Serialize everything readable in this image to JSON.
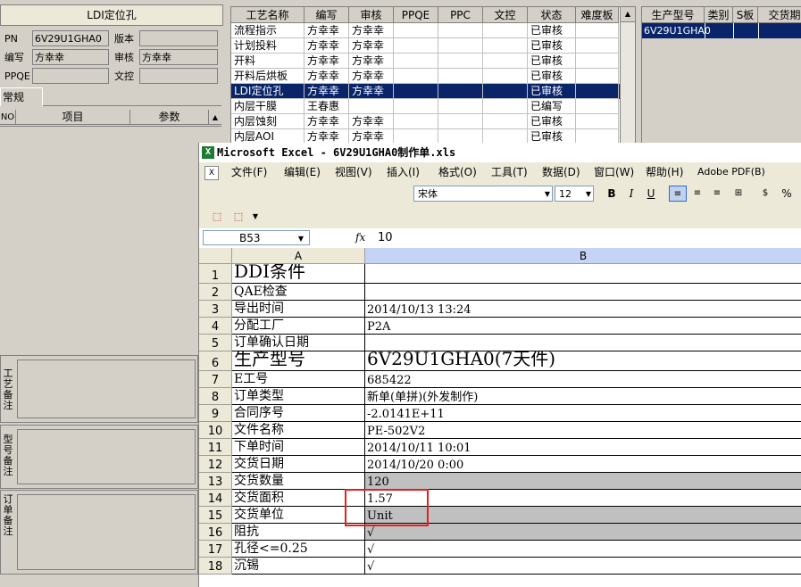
{
  "left": {
    "title": "LDI定位孔",
    "pn_label": "PN",
    "pn_value": "6V29U1GHA0",
    "version_label": "版本",
    "version_value": "",
    "author_label": "编写",
    "author_value": "方幸幸",
    "review_label": "审核",
    "review_value": "方幸幸",
    "ppqe_label": "PPQE",
    "ppqe_value": "",
    "doc_label": "文控",
    "doc_value": "",
    "tab_label": "常规",
    "grid_headers": [
      "NO",
      "项目",
      "参数"
    ],
    "remarks": [
      "工艺备注",
      "型号备注",
      "订单备注"
    ]
  },
  "process_table": {
    "headers": [
      "工艺名称",
      "编写",
      "审核",
      "PPQE",
      "PPC",
      "文控",
      "状态",
      "难度板"
    ],
    "rows": [
      [
        "流程指示",
        "方幸幸",
        "方幸幸",
        "",
        "",
        "",
        "已审核",
        ""
      ],
      [
        "计划投料",
        "方幸幸",
        "方幸幸",
        "",
        "",
        "",
        "已审核",
        ""
      ],
      [
        "开料",
        "方幸幸",
        "方幸幸",
        "",
        "",
        "",
        "已审核",
        ""
      ],
      [
        "开料后烘板",
        "方幸幸",
        "方幸幸",
        "",
        "",
        "",
        "已审核",
        ""
      ],
      [
        "LDI定位孔",
        "方幸幸",
        "方幸幸",
        "",
        "",
        "",
        "已审核",
        ""
      ],
      [
        "内层干膜",
        "王春惠",
        "",
        "",
        "",
        "",
        "已编写",
        ""
      ],
      [
        "内层蚀刻",
        "方幸幸",
        "方幸幸",
        "",
        "",
        "",
        "已审核",
        ""
      ],
      [
        "内层AOI",
        "方幸幸",
        "方幸幸",
        "",
        "",
        "",
        "已审核",
        ""
      ]
    ],
    "selected_row": 4
  },
  "model_table": {
    "headers": [
      "生产型号",
      "类别",
      "S板",
      "交货期"
    ],
    "rows": [
      [
        "6V29U1GHA0",
        "",
        "",
        ""
      ]
    ]
  },
  "excel": {
    "title": "Microsoft Excel - 6V29U1GHA0制作单.xls",
    "menus": [
      "文件(F)",
      "编辑(E)",
      "视图(V)",
      "插入(I)",
      "格式(O)",
      "工具(T)",
      "数据(D)",
      "窗口(W)",
      "帮助(H)",
      "Adobe PDF(B)"
    ],
    "font_name": "宋体",
    "font_size": "12",
    "cell_ref": "B53",
    "fx": "fx",
    "formula_value": "10",
    "col_headers": [
      "A",
      "B"
    ],
    "rows": [
      {
        "n": "1",
        "a": "DDI条件",
        "b": ""
      },
      {
        "n": "2",
        "a": "QAE检查",
        "b": ""
      },
      {
        "n": "3",
        "a": "导出时间",
        "b": "2014/10/13 13:24"
      },
      {
        "n": "4",
        "a": "分配工厂",
        "b": "P2A"
      },
      {
        "n": "5",
        "a": "订单确认日期",
        "b": ""
      },
      {
        "n": "6",
        "a": "生产型号",
        "b": "6V29U1GHA0(7天件)"
      },
      {
        "n": "7",
        "a": "E工号",
        "b": "685422"
      },
      {
        "n": "8",
        "a": "订单类型",
        "b": "新单(单拼)(外发制作)"
      },
      {
        "n": "9",
        "a": "合同序号",
        "b": "-2.0141E+11"
      },
      {
        "n": "10",
        "a": "文件名称",
        "b": "PE-502V2"
      },
      {
        "n": "11",
        "a": "下单时间",
        "b": "2014/10/11 10:01"
      },
      {
        "n": "12",
        "a": "交货日期",
        "b": "2014/10/20 0:00"
      },
      {
        "n": "13",
        "a": "交货数量",
        "b": "120"
      },
      {
        "n": "14",
        "a": "交货面积",
        "b": "1.57"
      },
      {
        "n": "15",
        "a": "交货单位",
        "b": "Unit"
      },
      {
        "n": "16",
        "a": "阻抗",
        "b": "√"
      },
      {
        "n": "17",
        "a": "孔径<=0.25",
        "b": "√"
      },
      {
        "n": "18",
        "a": "沉锡",
        "b": "√"
      }
    ]
  },
  "colors": {
    "selection": "#0a246a",
    "highlight_box": "#e31f1f",
    "shaded_cell": "#c0c0c0"
  }
}
